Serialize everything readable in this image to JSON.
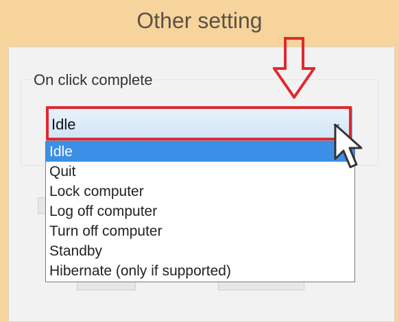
{
  "dialog": {
    "title": "Other setting"
  },
  "group": {
    "label": "On click complete"
  },
  "select": {
    "value": "Idle",
    "arrow_icon": "chevron-down-icon"
  },
  "dropdown": {
    "options": [
      "Idle",
      "Quit",
      "Lock computer",
      "Log off computer",
      "Turn off computer",
      "Standby",
      "Hibernate (only if supported)"
    ],
    "selected_index": 0
  },
  "annotation": {
    "color": "#e0282e",
    "arrow_icon": "red-down-arrow-icon",
    "box": "red-highlight-box"
  },
  "cursor": {
    "icon": "mouse-pointer-icon"
  }
}
